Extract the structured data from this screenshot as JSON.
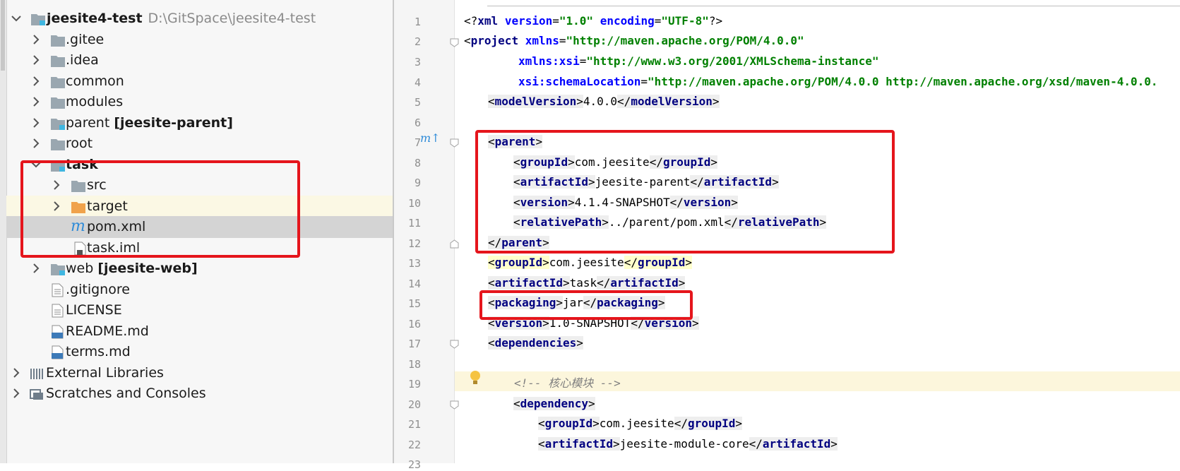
{
  "project_tree": {
    "root": {
      "name": "jeesite4-test",
      "path": "D:\\GitSpace\\jeesite4-test"
    },
    "items": [
      {
        "label": ".gitee"
      },
      {
        "label": ".idea"
      },
      {
        "label": "common"
      },
      {
        "label": "modules"
      },
      {
        "label": "parent",
        "module": "[jeesite-parent]"
      },
      {
        "label": "root"
      },
      {
        "label": "task"
      },
      {
        "label": "src"
      },
      {
        "label": "target"
      },
      {
        "label": "pom.xml"
      },
      {
        "label": "task.iml"
      },
      {
        "label": "web",
        "module": "[jeesite-web]"
      },
      {
        "label": ".gitignore"
      },
      {
        "label": "LICENSE"
      },
      {
        "label": "README.md"
      },
      {
        "label": "terms.md"
      },
      {
        "label": "External Libraries"
      },
      {
        "label": "Scratches and Consoles"
      }
    ]
  },
  "editor": {
    "line_numbers": [
      "1",
      "2",
      "3",
      "4",
      "5",
      "6",
      "7",
      "8",
      "9",
      "10",
      "11",
      "12",
      "13",
      "14",
      "15",
      "16",
      "17",
      "18",
      "19",
      "20",
      "21",
      "22",
      "23"
    ],
    "line1": {
      "decl": "xml",
      "a1": "version",
      "v1": "\"1.0\"",
      "a2": "encoding",
      "v2": "\"UTF-8\""
    },
    "line2": {
      "tag": "project",
      "a": "xmlns",
      "v": "\"http://maven.apache.org/POM/4.0.0\""
    },
    "line3": {
      "a": "xmlns:xsi",
      "v": "\"http://www.w3.org/2001/XMLSchema-instance\""
    },
    "line4": {
      "a": "xsi:schemaLocation",
      "v": "\"http://maven.apache.org/POM/4.0.0 http://maven.apache.org/xsd/maven-4.0.0."
    },
    "line5": {
      "tag": "modelVersion",
      "text": "4.0.0"
    },
    "line7": {
      "tag": "parent"
    },
    "line8": {
      "tag": "groupId",
      "text": "com.jeesite"
    },
    "line9": {
      "tag": "artifactId",
      "text": "jeesite-parent"
    },
    "line10": {
      "tag": "version",
      "text": "4.1.4-SNAPSHOT"
    },
    "line11": {
      "tag": "relativePath",
      "text": "../parent/pom.xml"
    },
    "line12": {
      "tag": "parent"
    },
    "line13": {
      "tag": "groupId",
      "text": "com.jeesite"
    },
    "line14": {
      "tag": "artifactId",
      "text": "task"
    },
    "line15": {
      "tag": "packaging",
      "text": "jar"
    },
    "line16": {
      "tag": "version",
      "text": "1.0-SNAPSHOT"
    },
    "line17": {
      "tag": "dependencies"
    },
    "line19": {
      "comment": "<!-- 核心模块 -->"
    },
    "line20": {
      "tag": "dependency"
    },
    "line21": {
      "tag": "groupId",
      "text": "com.jeesite"
    },
    "line22": {
      "tag": "artifactId",
      "text": "jeesite-module-core"
    }
  },
  "colors": {
    "annotation_red": "#e5151c",
    "tag_blue": "#000080",
    "attr_value_green": "#008000",
    "folder_orange": "#f0a24b"
  },
  "icons": [
    "chevron-right-icon",
    "chevron-down-icon",
    "module-folder-icon",
    "folder-icon",
    "excluded-folder-icon",
    "maven-file-icon",
    "iml-file-icon",
    "text-file-icon",
    "markdown-file-icon",
    "libraries-icon",
    "scratches-icon",
    "maven-override-icon",
    "intention-bulb-icon",
    "fold-icon"
  ]
}
